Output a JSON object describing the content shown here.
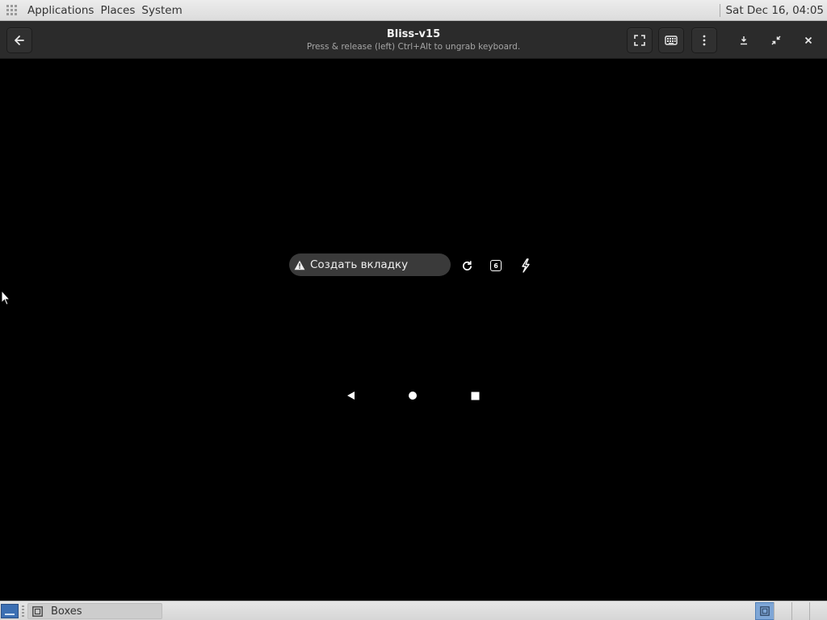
{
  "top_panel": {
    "menus": [
      "Applications",
      "Places",
      "System"
    ],
    "clock": "Sat Dec 16, 04:05"
  },
  "headerbar": {
    "title": "Bliss-v15",
    "subtitle": "Press & release (left) Ctrl+Alt to ungrab keyboard."
  },
  "guest": {
    "search_label": "Создать вкладку",
    "tab_count": "6"
  },
  "taskbar": {
    "task_label": "Boxes"
  },
  "colors": {
    "headerbar_bg": "#2b2b2b",
    "screen_bg": "#000000",
    "pill_bg": "#3a3a3a",
    "active_workspace": "#7ea6d6"
  }
}
